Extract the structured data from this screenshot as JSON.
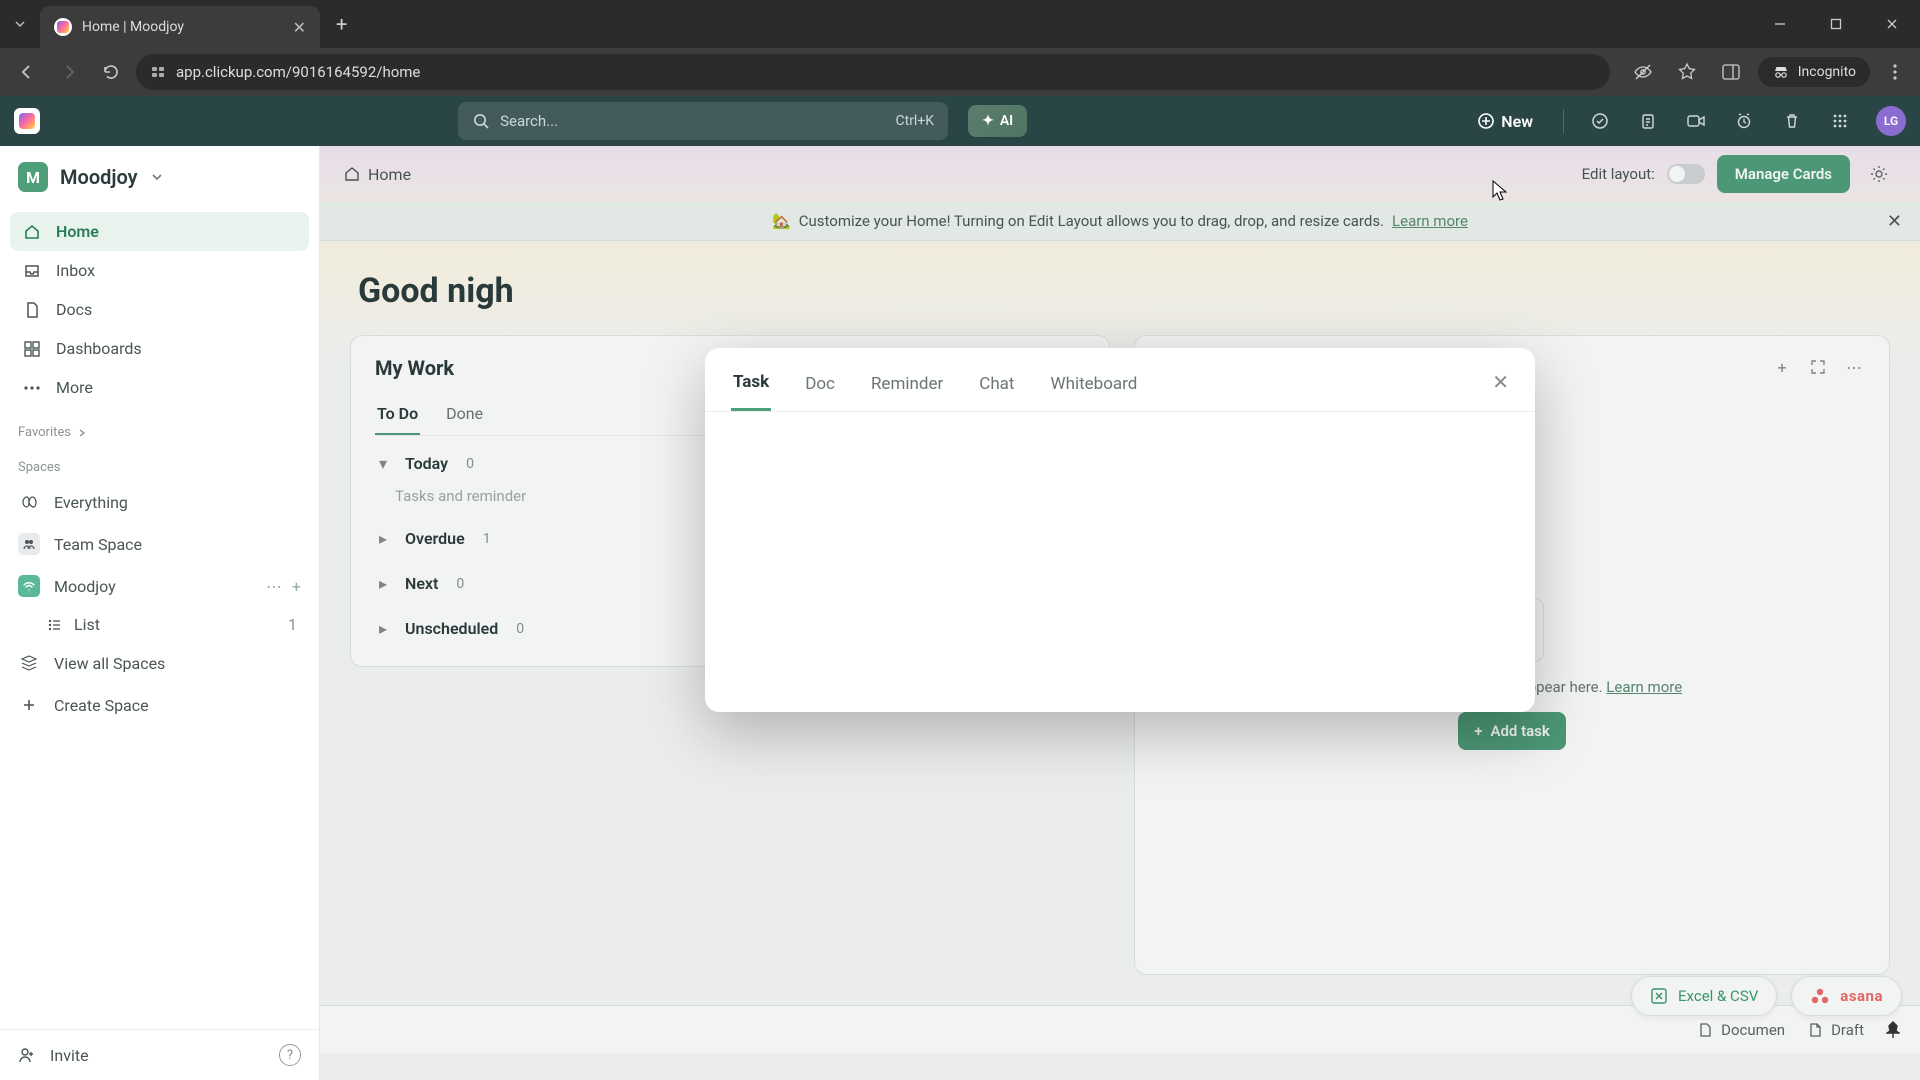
{
  "browser": {
    "tab_title": "Home | Moodjoy",
    "url": "app.clickup.com/9016164592/home",
    "incognito": "Incognito"
  },
  "app_header": {
    "search_placeholder": "Search...",
    "search_kbd": "Ctrl+K",
    "ai_label": "AI",
    "new_label": "New",
    "avatar": "LG"
  },
  "workspace": {
    "initial": "M",
    "name": "Moodjoy"
  },
  "sidebar": {
    "nav": [
      {
        "label": "Home",
        "active": true
      },
      {
        "label": "Inbox",
        "active": false
      },
      {
        "label": "Docs",
        "active": false
      },
      {
        "label": "Dashboards",
        "active": false
      },
      {
        "label": "More",
        "active": false
      }
    ],
    "favorites_label": "Favorites",
    "spaces_label": "Spaces",
    "spaces": {
      "everything": "Everything",
      "team": "Team Space",
      "moodjoy": "Moodjoy",
      "list": "List",
      "list_count": "1",
      "view_all": "View all Spaces",
      "create": "Create Space"
    },
    "invite": "Invite"
  },
  "breadcrumb": "Home",
  "edit_layout_label": "Edit layout:",
  "manage_cards": "Manage Cards",
  "banner": {
    "emoji": "🏡",
    "text": "Customize your Home! Turning on Edit Layout allows you to drag, drop, and resize cards.",
    "learn_more": "Learn more"
  },
  "greeting": "Good nigh",
  "mywork": {
    "title": "My Work",
    "tabs": {
      "todo": "To Do",
      "done": "Done"
    },
    "groups": [
      {
        "name": "Today",
        "count": "0",
        "expanded": true,
        "hint": "Tasks and reminder"
      },
      {
        "name": "Overdue",
        "count": "1",
        "expanded": false
      },
      {
        "name": "Next",
        "count": "0",
        "expanded": false
      },
      {
        "name": "Unscheduled",
        "count": "0",
        "expanded": false
      }
    ]
  },
  "assigned": {
    "empty_text": "Tasks assigned to you will appear here.",
    "learn_more": "Learn more",
    "add_task": "Add task"
  },
  "pills": {
    "excel": "Excel & CSV",
    "asana": "asana"
  },
  "footer": {
    "document": "Documen",
    "draft": "Draft"
  },
  "modal": {
    "tabs": [
      "Task",
      "Doc",
      "Reminder",
      "Chat",
      "Whiteboard"
    ],
    "active": 0
  }
}
